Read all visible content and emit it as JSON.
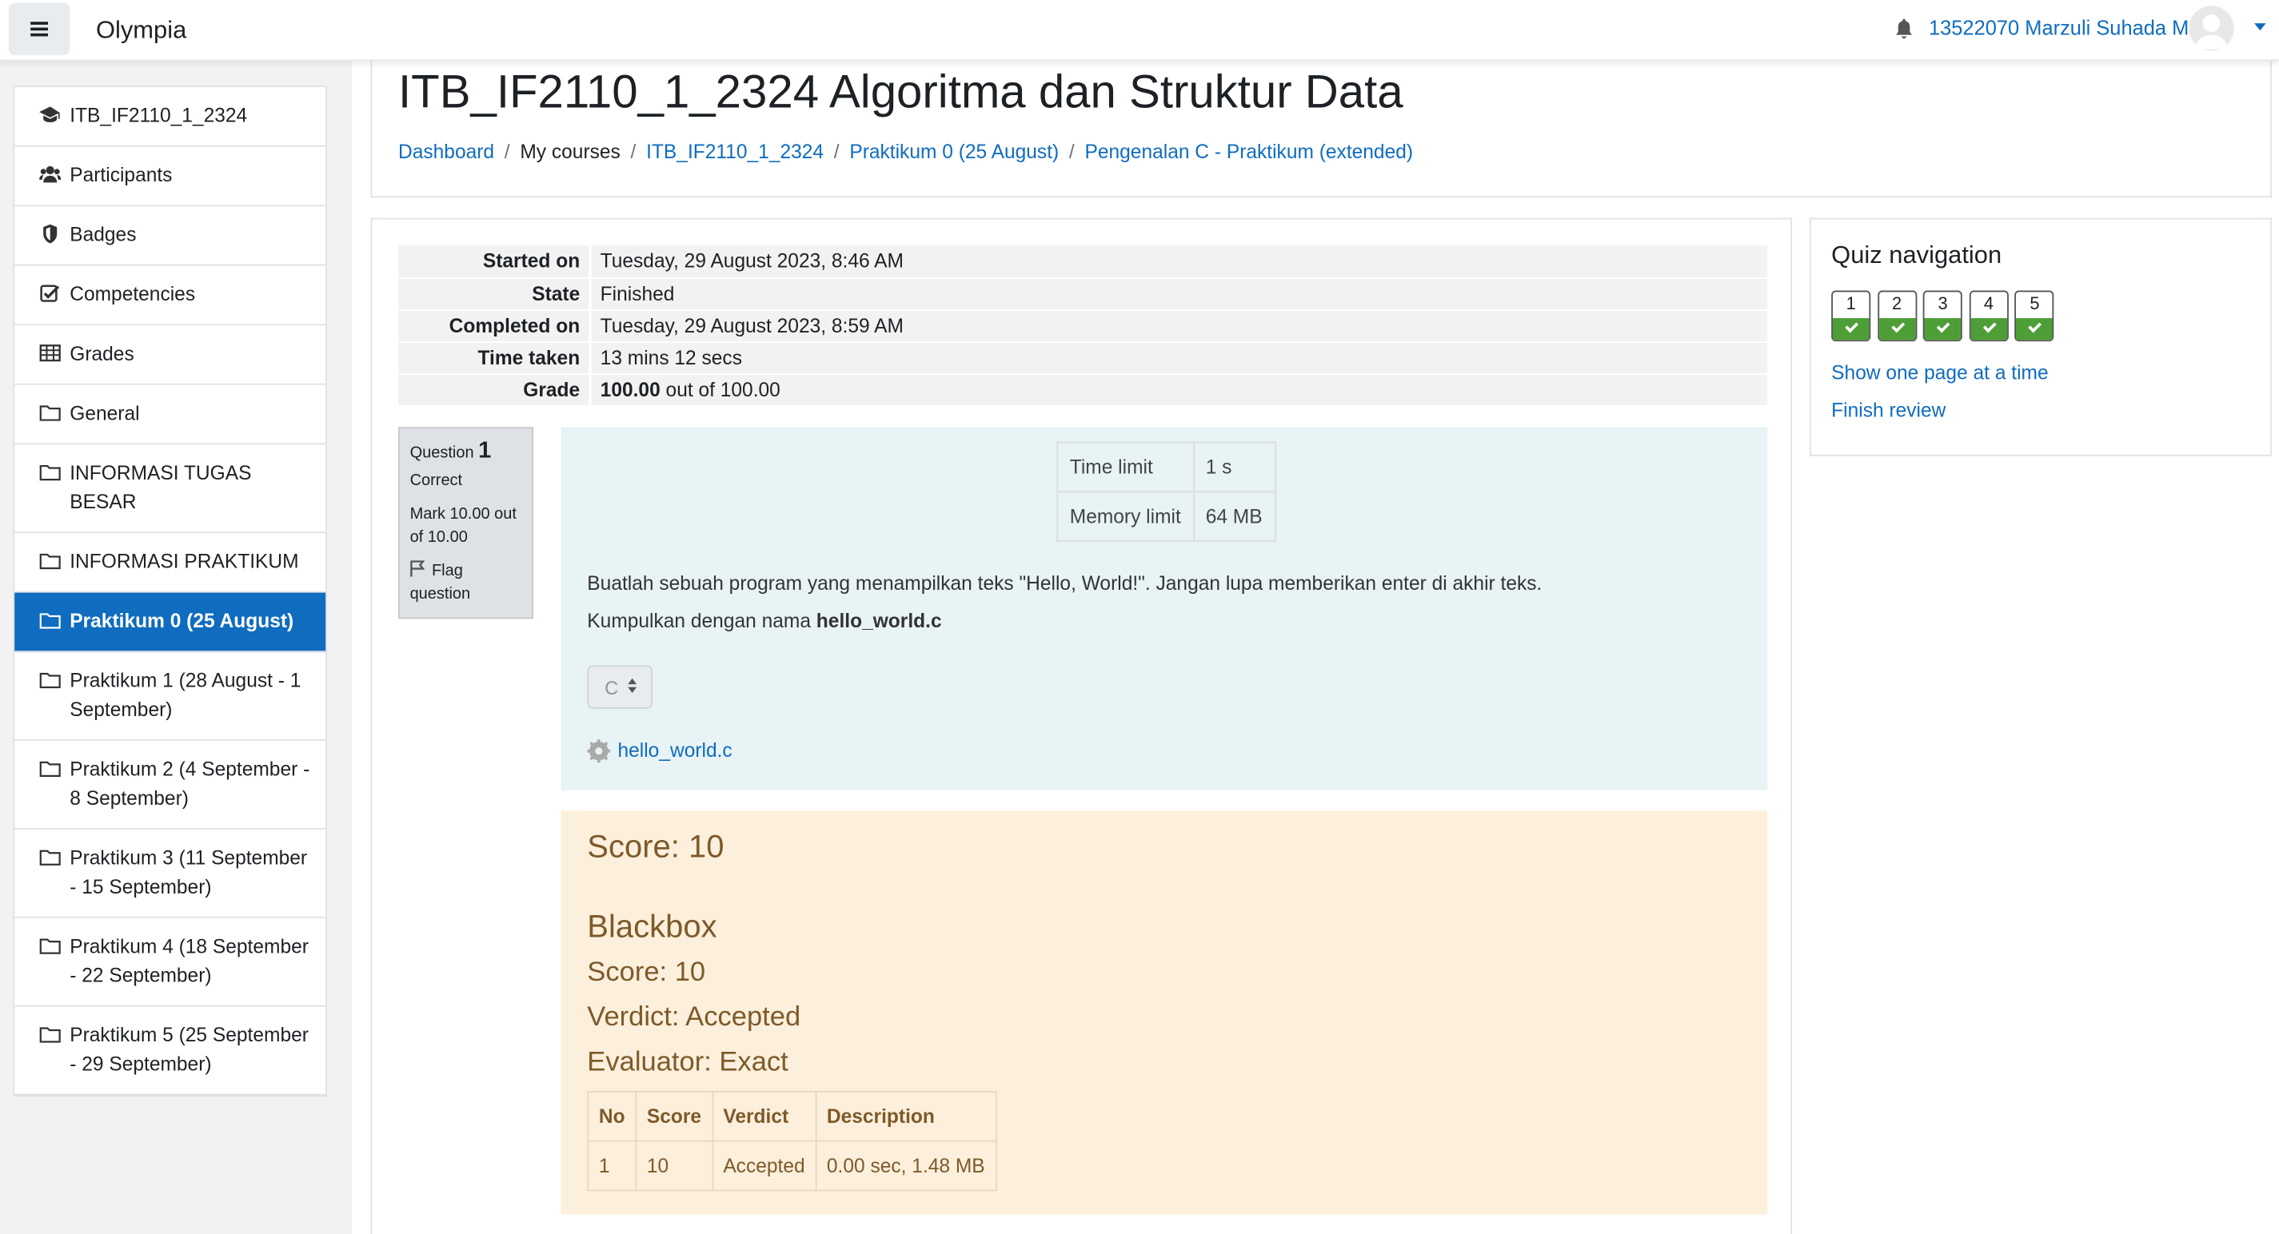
{
  "navbar": {
    "brand": "Olympia",
    "user": "13522070 Marzuli Suhada M."
  },
  "drawer": {
    "items": [
      {
        "label": "ITB_IF2110_1_2324",
        "icon": "graduation-cap-icon"
      },
      {
        "label": "Participants",
        "icon": "users-icon"
      },
      {
        "label": "Badges",
        "icon": "shield-icon"
      },
      {
        "label": "Competencies",
        "icon": "check-square-icon"
      },
      {
        "label": "Grades",
        "icon": "table-icon"
      },
      {
        "label": "General",
        "icon": "folder-icon"
      },
      {
        "label": "INFORMASI TUGAS BESAR",
        "icon": "folder-icon"
      },
      {
        "label": "INFORMASI PRAKTIKUM",
        "icon": "folder-icon"
      },
      {
        "label": "Praktikum 0 (25 August)",
        "icon": "folder-icon",
        "active": true
      },
      {
        "label": "Praktikum 1 (28 August - 1 September)",
        "icon": "folder-icon"
      },
      {
        "label": "Praktikum 2 (4 September - 8 September)",
        "icon": "folder-icon"
      },
      {
        "label": "Praktikum 3 (11 September - 15 September)",
        "icon": "folder-icon"
      },
      {
        "label": "Praktikum 4 (18 September - 22 September)",
        "icon": "folder-icon"
      },
      {
        "label": "Praktikum 5 (25 September - 29 September)",
        "icon": "folder-icon"
      }
    ]
  },
  "header": {
    "title": "ITB_IF2110_1_2324 Algoritma dan Struktur Data",
    "breadcrumbs": [
      "Dashboard",
      "My courses",
      "ITB_IF2110_1_2324",
      "Praktikum 0 (25 August)",
      "Pengenalan C - Praktikum (extended)"
    ]
  },
  "summary": [
    {
      "k": "Started on",
      "v": "Tuesday, 29 August 2023, 8:46 AM"
    },
    {
      "k": "State",
      "v": "Finished"
    },
    {
      "k": "Completed on",
      "v": "Tuesday, 29 August 2023, 8:59 AM"
    },
    {
      "k": "Time taken",
      "v": "13 mins 12 secs"
    },
    {
      "k": "Grade",
      "v_bold": "100.00",
      "v": " out of 100.00"
    }
  ],
  "question": {
    "label": "Question",
    "number": "1",
    "status": "Correct",
    "mark": "Mark 10.00 out of 10.00",
    "flag": "Flag question",
    "limits": [
      {
        "k": "Time limit",
        "v": "1 s"
      },
      {
        "k": "Memory limit",
        "v": "64 MB"
      }
    ],
    "text": "Buatlah sebuah program yang menampilkan teks \"Hello, World!\". Jangan lupa memberikan enter di akhir teks.",
    "submit_prefix": "Kumpulkan dengan nama ",
    "submit_file": "hello_world.c",
    "language": "C",
    "attachment": "hello_world.c"
  },
  "feedback": {
    "score": "Score: 10",
    "section": "Blackbox",
    "score2": "Score: 10",
    "verdict": "Verdict: Accepted",
    "evaluator": "Evaluator: Exact",
    "headers": [
      "No",
      "Score",
      "Verdict",
      "Description"
    ],
    "rows": [
      [
        "1",
        "10",
        "Accepted",
        "0.00 sec, 1.48 MB"
      ]
    ]
  },
  "quiznav": {
    "title": "Quiz navigation",
    "buttons": [
      "1",
      "2",
      "3",
      "4",
      "5"
    ],
    "show_one_page": "Show one page at a time",
    "finish_review": "Finish review"
  },
  "colors": {
    "accent": "#0f6cbf",
    "correct": "#4e9e38",
    "feedback_bg": "#fcefdc",
    "question_bg": "#e7f3f5"
  }
}
